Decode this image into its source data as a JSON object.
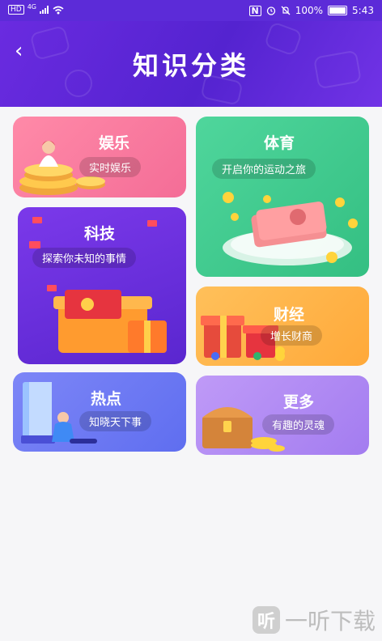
{
  "status_bar": {
    "carrier_badge": "HD",
    "network": "4G",
    "battery": "100%",
    "time": "5:43"
  },
  "header": {
    "back_glyph": "‹",
    "title": "知识分类"
  },
  "categories": [
    {
      "name": "娱乐",
      "subtitle": "实时娱乐",
      "color": "#f7799e"
    },
    {
      "name": "体育",
      "subtitle": "开启你的运动之旅",
      "color": "#43cc8f"
    },
    {
      "name": "科技",
      "subtitle": "探索你未知的事情",
      "color": "#6c2fe0"
    },
    {
      "name": "财经",
      "subtitle": "增长财商",
      "color": "#ffb347"
    },
    {
      "name": "热点",
      "subtitle": "知晓天下事",
      "color": "#6e7af5"
    },
    {
      "name": "更多",
      "subtitle": "有趣的灵魂",
      "color": "#b08cf3"
    }
  ],
  "watermark": {
    "logo_char": "听",
    "text": "一听下载"
  }
}
